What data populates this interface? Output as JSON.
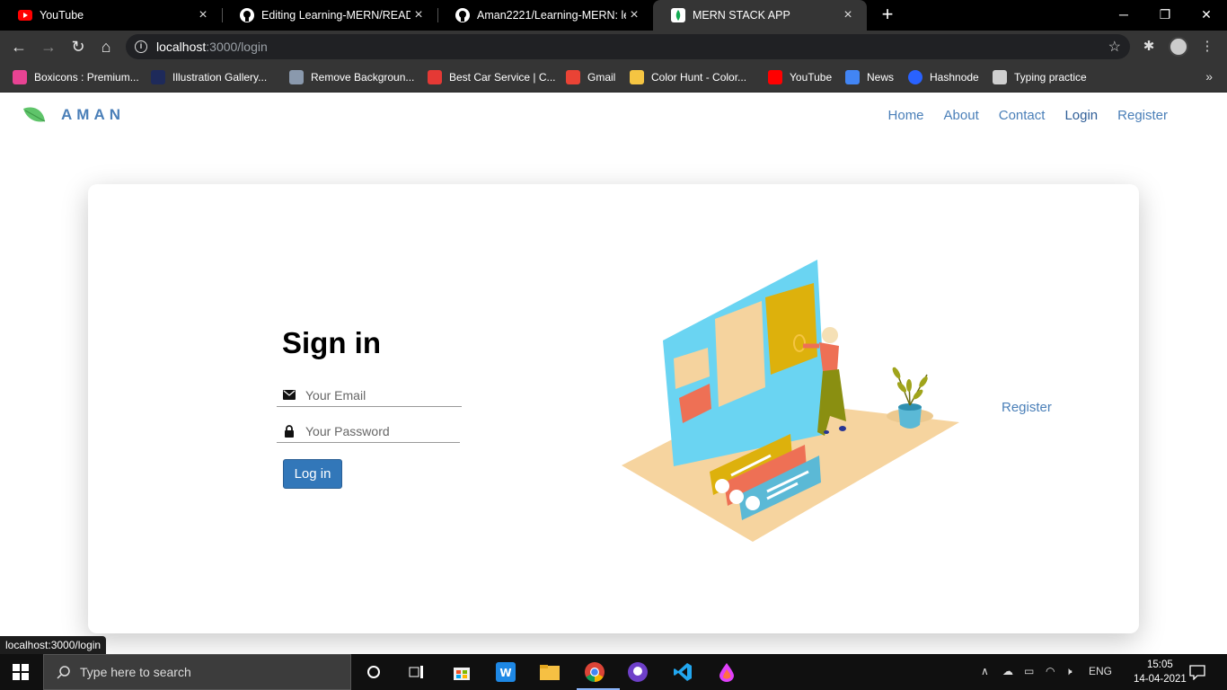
{
  "browser": {
    "tabs": [
      {
        "title": "YouTube",
        "icon": "youtube-icon",
        "active": false
      },
      {
        "title": "Editing Learning-MERN/README",
        "icon": "github-icon",
        "active": false
      },
      {
        "title": "Aman2221/Learning-MERN: learn",
        "icon": "github-icon",
        "active": false
      },
      {
        "title": "MERN STACK APP",
        "icon": "mongodb-leaf-icon",
        "active": true
      }
    ],
    "url_host": "localhost",
    "url_path": ":3000/login",
    "bookmarks": [
      {
        "label": "Boxicons : Premium...",
        "color": "#e84393"
      },
      {
        "label": "Illustration Gallery...",
        "color": "#1e2a5a"
      },
      {
        "label": "Remove Backgroun...",
        "color": "#8a99ad"
      },
      {
        "label": "Best Car Service | C...",
        "color": "#e53935"
      },
      {
        "label": "Gmail",
        "color": "#ea4335"
      },
      {
        "label": "Color Hunt - Color...",
        "color": "#f5c542"
      },
      {
        "label": "YouTube",
        "color": "#ff0000"
      },
      {
        "label": "News",
        "color": "#4285f4"
      },
      {
        "label": "Hashnode",
        "color": "#2962ff"
      },
      {
        "label": "Typing practice",
        "color": "#cfcfcf"
      }
    ]
  },
  "site": {
    "brand": "AMAN",
    "nav": [
      "Home",
      "About",
      "Contact",
      "Login",
      "Register"
    ],
    "signin": {
      "title": "Sign in",
      "email_placeholder": "Your Email",
      "password_placeholder": "Your Password",
      "button": "Log in",
      "register_link": "Register"
    }
  },
  "status_bar": "localhost:3000/login",
  "taskbar": {
    "search_placeholder": "Type here to search",
    "lang": "ENG",
    "time": "15:05",
    "date": "14-04-2021"
  }
}
